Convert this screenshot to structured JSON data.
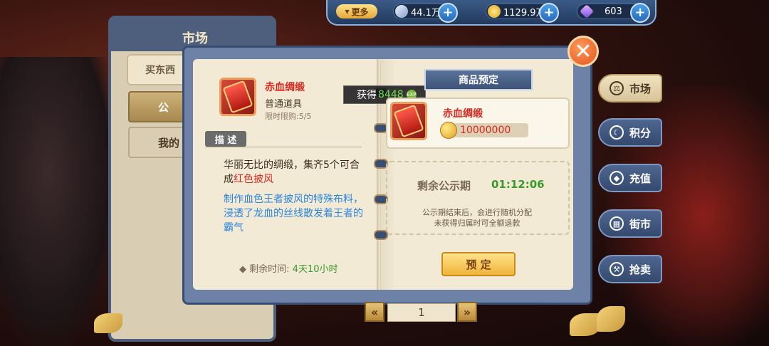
{
  "topbar": {
    "more_label": "更多",
    "silver": "44.1万",
    "gold": "1129.9万",
    "diamond": "603",
    "plus": "+"
  },
  "market": {
    "title": "市场",
    "tab_buy": "买东西",
    "side_buttons": [
      "公",
      "我的"
    ]
  },
  "right_nav": [
    {
      "label": "市场",
      "icon": "scale-icon"
    },
    {
      "label": "积分",
      "icon": "moon-icon"
    },
    {
      "label": "充值",
      "icon": "gem-icon"
    },
    {
      "label": "街市",
      "icon": "shop-icon"
    },
    {
      "label": "抢卖",
      "icon": "gavel-icon"
    }
  ],
  "left_page": {
    "item_name": "赤血绸缎",
    "item_type": "普通道具",
    "limit": "限时限购:5/5",
    "desc_header": "描 述",
    "desc_main_prefix": "华丽无比的绸缎，集齐5个可合成",
    "desc_main_highlight": "红色披风",
    "desc_flavor": "制作血色王者披风的特殊布料，浸透了龙血的丝线散发着王者的霸气",
    "remain_label": "剩余时间:",
    "remain_value": "4天10小时"
  },
  "exp_tooltip": {
    "label": "获得",
    "value": "8448",
    "badge": "EXP"
  },
  "right_page": {
    "section_title": "商品预定",
    "item_name": "赤血绸缎",
    "price": "10000000",
    "countdown_label": "剩余公示期",
    "countdown_value": "01:12:06",
    "notice_line1": "公示期结束后，会进行随机分配",
    "notice_line2": "未获得归属时可全额退款",
    "reserve_label": "预 定"
  },
  "pager": {
    "page": "1",
    "prev": "«",
    "next": "»"
  },
  "close_label": "✕",
  "colors": {
    "accent_red": "#d8281e",
    "green": "#3a9a2a",
    "blue_text": "#2a86e0",
    "panel_blue": "#6e82a8"
  }
}
